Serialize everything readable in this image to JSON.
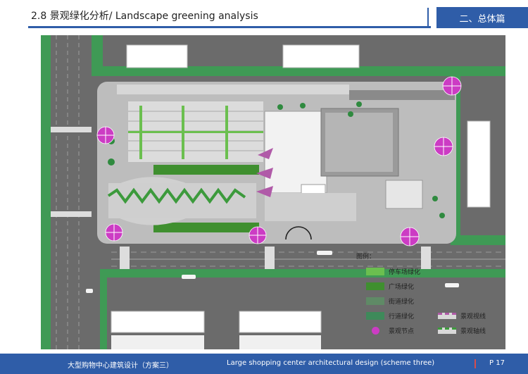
{
  "header": {
    "section_title": "2.8  景观绿化分析/ Landscape greening analysis",
    "tab_label": "二、总体篇"
  },
  "legend": {
    "title": "图例：",
    "items": [
      {
        "label": "停车场绿化",
        "color": "#6bbf4f"
      },
      {
        "label": "广场绿化",
        "color": "#3f8f2f"
      },
      {
        "label": "街道绿化",
        "color": "#5f8a66"
      },
      {
        "label": "行道绿化",
        "color": "#3e8a5a"
      },
      {
        "label": "景观视线",
        "color": "#b05aa8"
      },
      {
        "label": "景观节点",
        "color": "#cc3cc4"
      },
      {
        "label": "景观轴线",
        "color": "#3c9a3c"
      }
    ]
  },
  "footer": {
    "left_text": "大型购物中心建筑设计（方案三）",
    "center_text": "Large shopping center architectural design (scheme three)",
    "page_label": "P  17"
  },
  "colors": {
    "brand_blue": "#2f5da8",
    "page_mark_red": "#d64d4d"
  }
}
